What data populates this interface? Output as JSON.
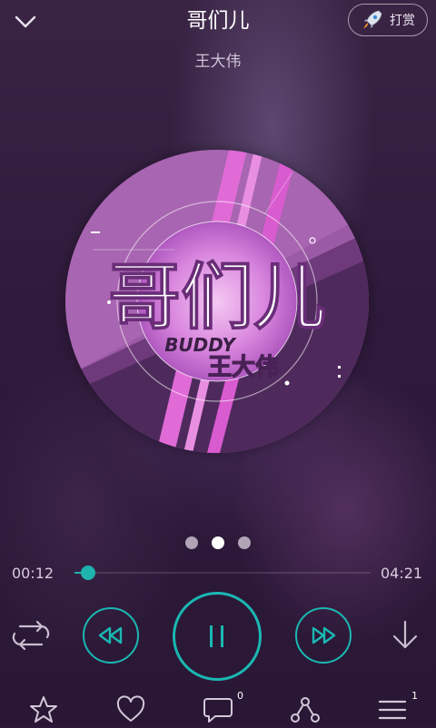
{
  "header": {
    "title": "哥们儿",
    "artist": "王大伟",
    "reward_label": "打赏"
  },
  "album": {
    "art_title": "哥们儿",
    "art_subtitle": "BUDDY",
    "art_artist": "王大伟"
  },
  "player": {
    "elapsed": "00:12",
    "duration": "04:21",
    "progress": 0.046,
    "page_dots": 3,
    "active_dot": 1
  },
  "bottom_bar": {
    "comment_count": "0",
    "playlist_count": "1"
  },
  "colors": {
    "accent": "#1fb3ad",
    "background": "#2d1838"
  }
}
